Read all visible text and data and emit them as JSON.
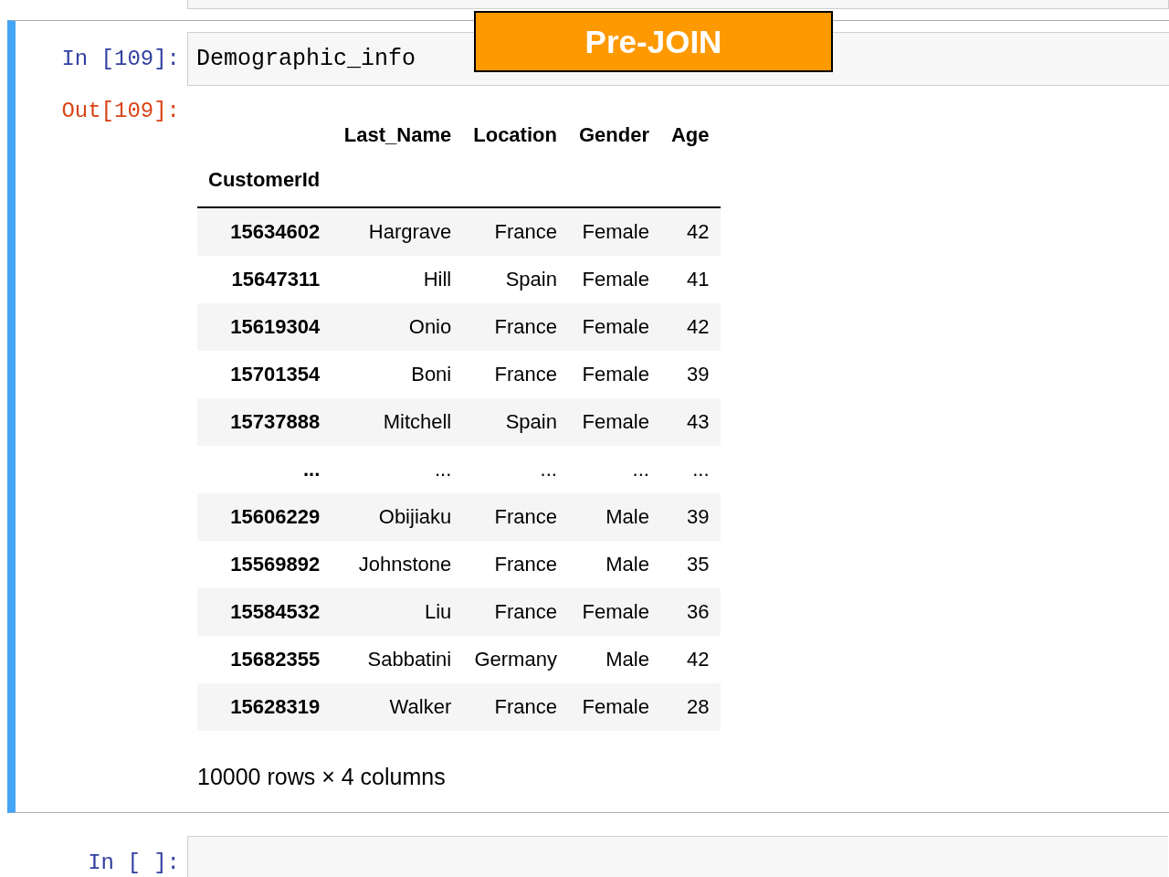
{
  "annotation": {
    "text": "Pre-JOIN"
  },
  "cells": [
    {
      "selected": true,
      "prompt": "In [109]:",
      "code": "Demographic_info",
      "output": {
        "prompt": "Out[109]:",
        "columns": [
          "",
          "Last_Name",
          "Location",
          "Gender",
          "Age"
        ],
        "index_name": "CustomerId",
        "rows": [
          [
            "15634602",
            "Hargrave",
            "France",
            "Female",
            "42"
          ],
          [
            "15647311",
            "Hill",
            "Spain",
            "Female",
            "41"
          ],
          [
            "15619304",
            "Onio",
            "France",
            "Female",
            "42"
          ],
          [
            "15701354",
            "Boni",
            "France",
            "Female",
            "39"
          ],
          [
            "15737888",
            "Mitchell",
            "Spain",
            "Female",
            "43"
          ],
          [
            "...",
            "...",
            "...",
            "...",
            "..."
          ],
          [
            "15606229",
            "Obijiaku",
            "France",
            "Male",
            "39"
          ],
          [
            "15569892",
            "Johnstone",
            "France",
            "Male",
            "35"
          ],
          [
            "15584532",
            "Liu",
            "France",
            "Female",
            "36"
          ],
          [
            "15682355",
            "Sabbatini",
            "Germany",
            "Male",
            "42"
          ],
          [
            "15628319",
            "Walker",
            "France",
            "Female",
            "28"
          ]
        ],
        "summary": "10000 rows × 4 columns"
      }
    },
    {
      "selected": false,
      "prompt": "In [ ]:"
    }
  ]
}
